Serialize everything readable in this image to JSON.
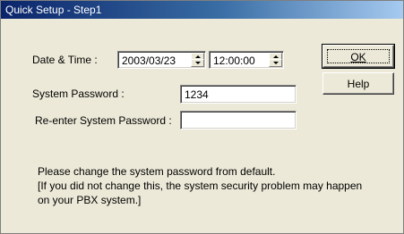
{
  "window": {
    "title": "Quick Setup - Step1"
  },
  "form": {
    "date_time_label": "Date & Time :",
    "date_value": "2003/03/23",
    "time_value": "12:00:00",
    "password_label": "System Password :",
    "password_value": "1234",
    "reenter_label": "Re-enter System Password :",
    "reenter_value": ""
  },
  "buttons": {
    "ok": "OK",
    "help": "Help"
  },
  "message": {
    "line1": "Please change the system password from default.",
    "line2": "[If you did not change this, the system security problem may happen",
    "line3": "on your PBX system.]"
  }
}
